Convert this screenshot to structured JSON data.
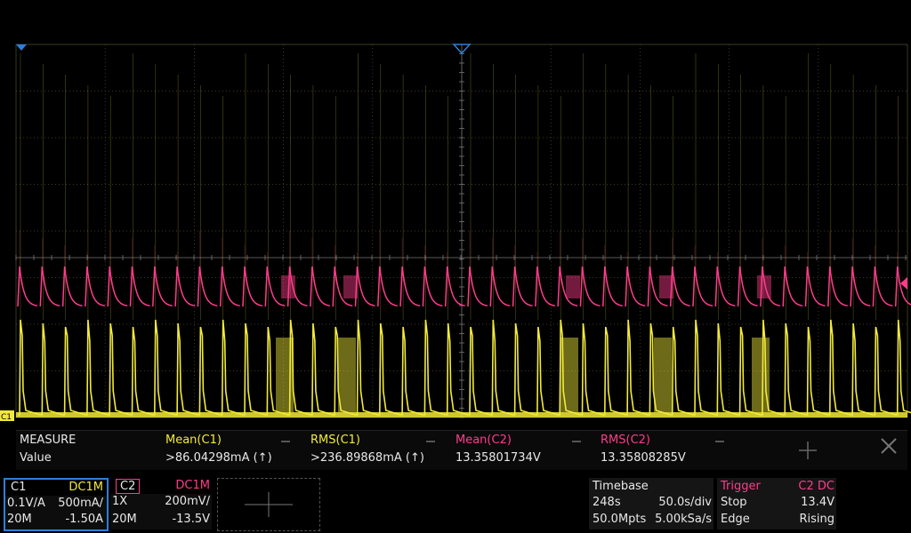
{
  "colors": {
    "ch1": "#f2ea3a",
    "ch2": "#ff3c8c",
    "grid": "#505030",
    "accent": "#2f7fd8"
  },
  "markers": {
    "ch1_label": "C1",
    "ch2_label": "C2"
  },
  "measure": {
    "title": "MEASURE",
    "row_label": "Value",
    "items": [
      {
        "name": "Mean(C1)",
        "value": ">86.04298mA (↑)",
        "color": "#f2ea3a"
      },
      {
        "name": "RMS(C1)",
        "value": ">236.89868mA (↑)",
        "color": "#f2ea3a"
      },
      {
        "name": "Mean(C2)",
        "value": "13.35801734V",
        "color": "#ff3c8c"
      },
      {
        "name": "RMS(C2)",
        "value": "13.35808285V",
        "color": "#ff3c8c"
      }
    ],
    "add_icon": "plus-icon",
    "close_icon": "close-icon"
  },
  "ch1": {
    "name": "C1",
    "coupling": "DC1M",
    "scale1": "0.1V/A",
    "scale2": "500mA/",
    "bw": "20M",
    "offset": "-1.50A"
  },
  "ch2": {
    "name": "C2",
    "coupling": "DC1M",
    "probe": "1X",
    "scale": "200mV/",
    "bw": "20M",
    "offset": "-13.5V"
  },
  "timebase": {
    "title": "Timebase",
    "delay": "248s",
    "scale": "50.0s/div",
    "points": "50.0Mpts",
    "rate": "5.00kSa/s"
  },
  "trigger": {
    "title": "Trigger",
    "source": "C2 DC",
    "mode": "Stop",
    "level": "13.4V",
    "type": "Edge",
    "slope": "Rising"
  }
}
